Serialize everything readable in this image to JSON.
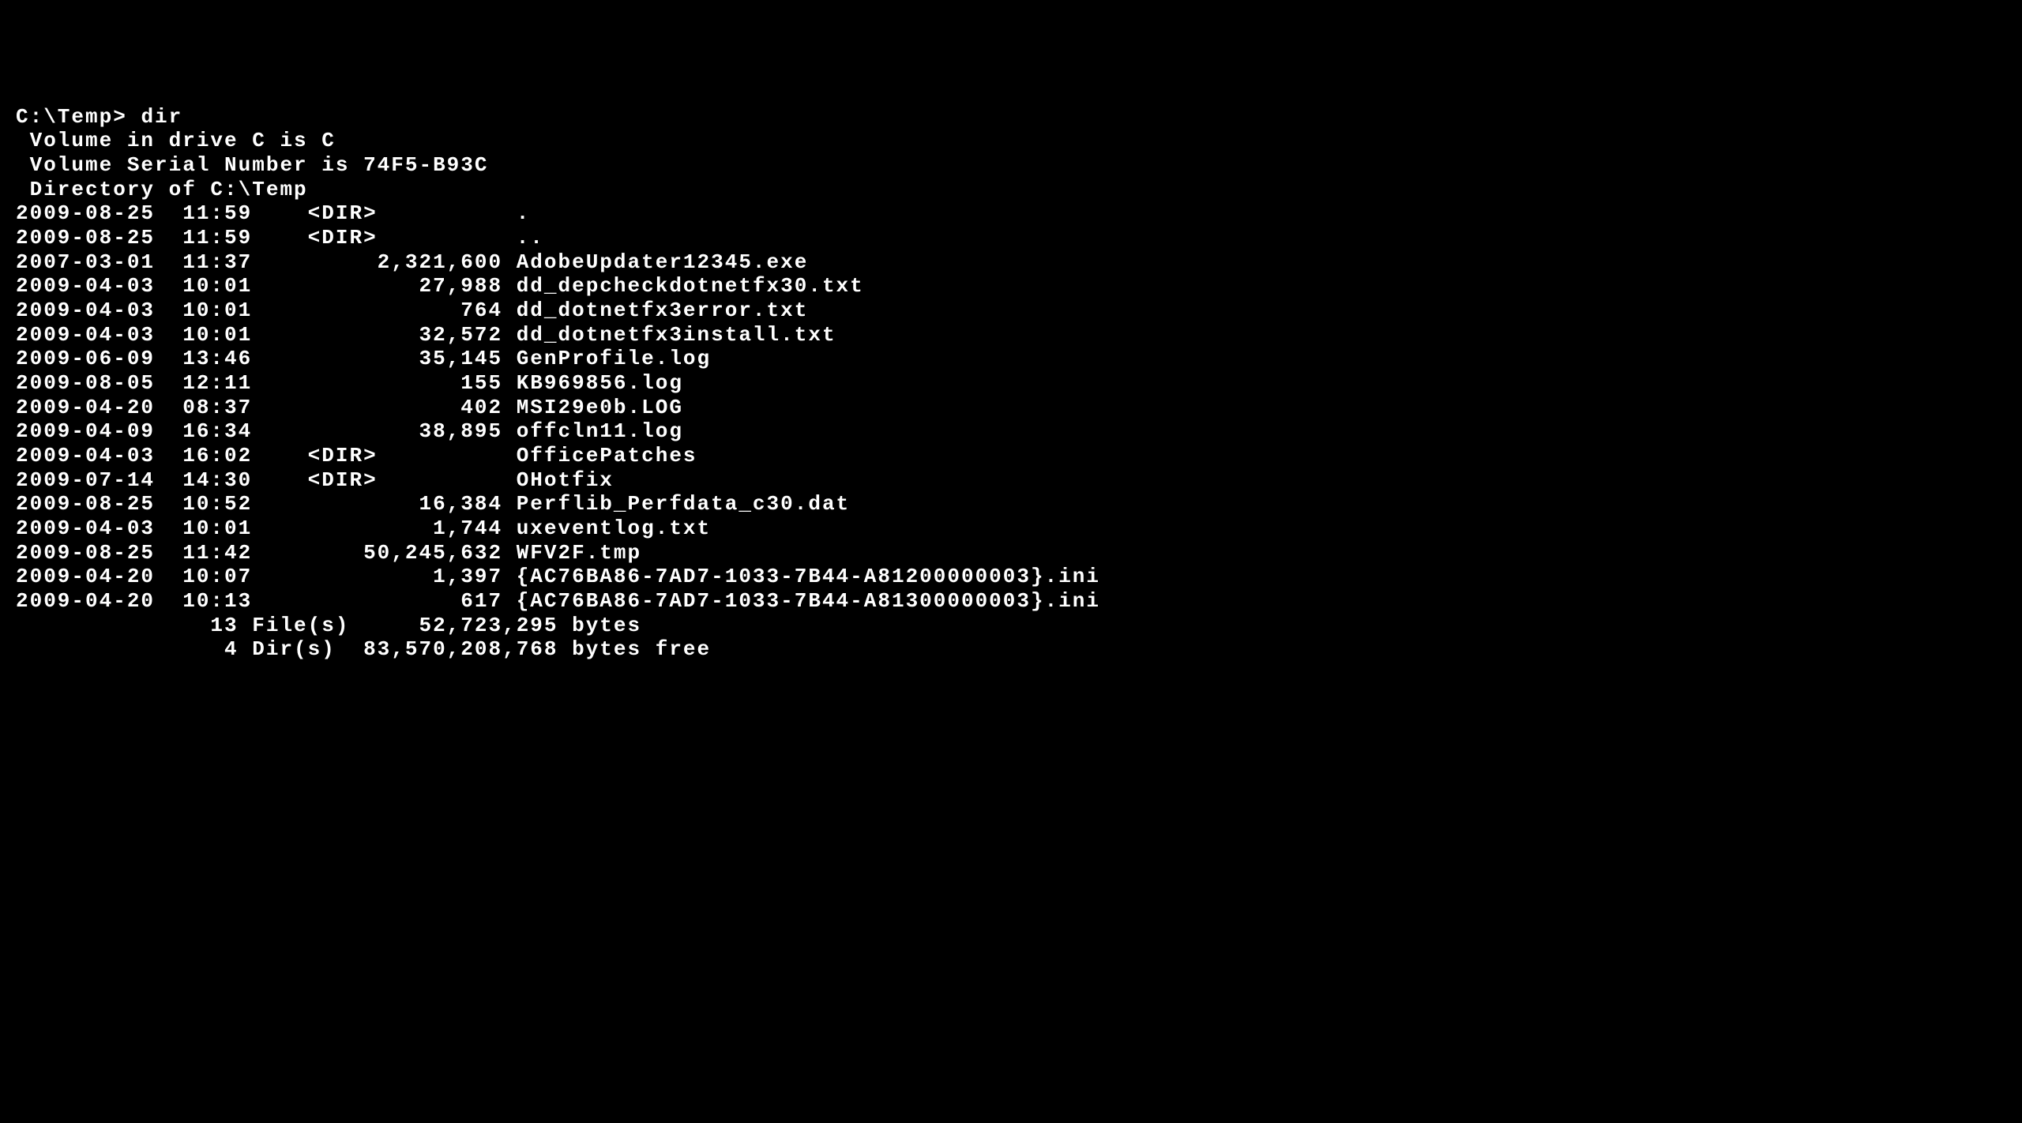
{
  "prompt": "C:\\Temp>",
  "command": "dir",
  "volume_line": " Volume in drive C is C",
  "serial_line": " Volume Serial Number is 74F5-B93C",
  "blank": "",
  "directory_line": " Directory of C:\\Temp",
  "entries": [
    {
      "date": "2009-08-25",
      "time": "11:59",
      "size_or_dir": "<DIR>         ",
      "name": "."
    },
    {
      "date": "2009-08-25",
      "time": "11:59",
      "size_or_dir": "<DIR>         ",
      "name": ".."
    },
    {
      "date": "2007-03-01",
      "time": "11:37",
      "size_or_dir": "     2,321,600",
      "name": "AdobeUpdater12345.exe"
    },
    {
      "date": "2009-04-03",
      "time": "10:01",
      "size_or_dir": "        27,988",
      "name": "dd_depcheckdotnetfx30.txt"
    },
    {
      "date": "2009-04-03",
      "time": "10:01",
      "size_or_dir": "           764",
      "name": "dd_dotnetfx3error.txt"
    },
    {
      "date": "2009-04-03",
      "time": "10:01",
      "size_or_dir": "        32,572",
      "name": "dd_dotnetfx3install.txt"
    },
    {
      "date": "2009-06-09",
      "time": "13:46",
      "size_or_dir": "        35,145",
      "name": "GenProfile.log"
    },
    {
      "date": "2009-08-05",
      "time": "12:11",
      "size_or_dir": "           155",
      "name": "KB969856.log"
    },
    {
      "date": "2009-04-20",
      "time": "08:37",
      "size_or_dir": "           402",
      "name": "MSI29e0b.LOG"
    },
    {
      "date": "2009-04-09",
      "time": "16:34",
      "size_or_dir": "        38,895",
      "name": "offcln11.log"
    },
    {
      "date": "2009-04-03",
      "time": "16:02",
      "size_or_dir": "<DIR>         ",
      "name": "OfficePatches"
    },
    {
      "date": "2009-07-14",
      "time": "14:30",
      "size_or_dir": "<DIR>         ",
      "name": "OHotfix"
    },
    {
      "date": "2009-08-25",
      "time": "10:52",
      "size_or_dir": "        16,384",
      "name": "Perflib_Perfdata_c30.dat"
    },
    {
      "date": "2009-04-03",
      "time": "10:01",
      "size_or_dir": "         1,744",
      "name": "uxeventlog.txt"
    },
    {
      "date": "2009-08-25",
      "time": "11:42",
      "size_or_dir": "    50,245,632",
      "name": "WFV2F.tmp"
    },
    {
      "date": "2009-04-20",
      "time": "10:07",
      "size_or_dir": "         1,397",
      "name": "{AC76BA86-7AD7-1033-7B44-A81200000003}.ini"
    },
    {
      "date": "2009-04-20",
      "time": "10:13",
      "size_or_dir": "           617",
      "name": "{AC76BA86-7AD7-1033-7B44-A81300000003}.ini"
    }
  ],
  "summary_files": "              13 File(s)     52,723,295 bytes",
  "summary_dirs": "               4 Dir(s)  83,570,208,768 bytes free"
}
